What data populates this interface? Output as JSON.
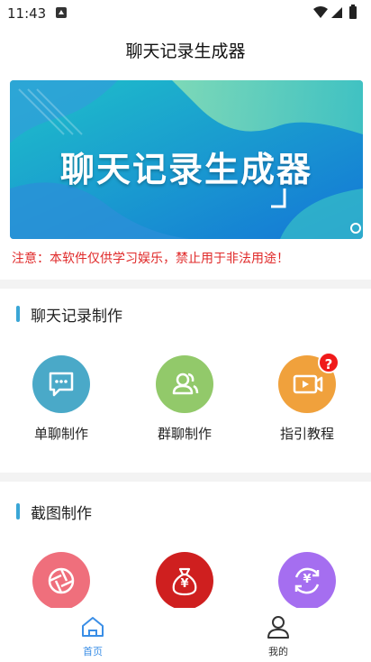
{
  "status": {
    "time": "11:43"
  },
  "appbar": {
    "title": "聊天记录生成器"
  },
  "banner": {
    "text": "聊天记录生成器"
  },
  "notice": "注意：本软件仅供学习娱乐，禁止用于非法用途！",
  "sections": [
    {
      "title": "聊天记录制作",
      "tools": [
        {
          "label": "单聊制作",
          "color": "#4aa9c8",
          "icon": "chat-bubble-icon"
        },
        {
          "label": "群聊制作",
          "color": "#92c96a",
          "icon": "group-icon"
        },
        {
          "label": "指引教程",
          "color": "#f0a13c",
          "icon": "video-icon",
          "badge": "?"
        }
      ]
    },
    {
      "title": "截图制作",
      "tools": [
        {
          "label": "",
          "color": "#ef6f7c",
          "icon": "aperture-icon"
        },
        {
          "label": "",
          "color": "#cf1f1f",
          "icon": "money-bag-icon",
          "symbol": "¥"
        },
        {
          "label": "",
          "color": "#a56ef0",
          "icon": "exchange-icon",
          "symbol": "¥"
        }
      ]
    }
  ],
  "tabbar": {
    "home": "首页",
    "mine": "我的",
    "active_color": "#3a8ee6",
    "inactive_color": "#333333"
  }
}
